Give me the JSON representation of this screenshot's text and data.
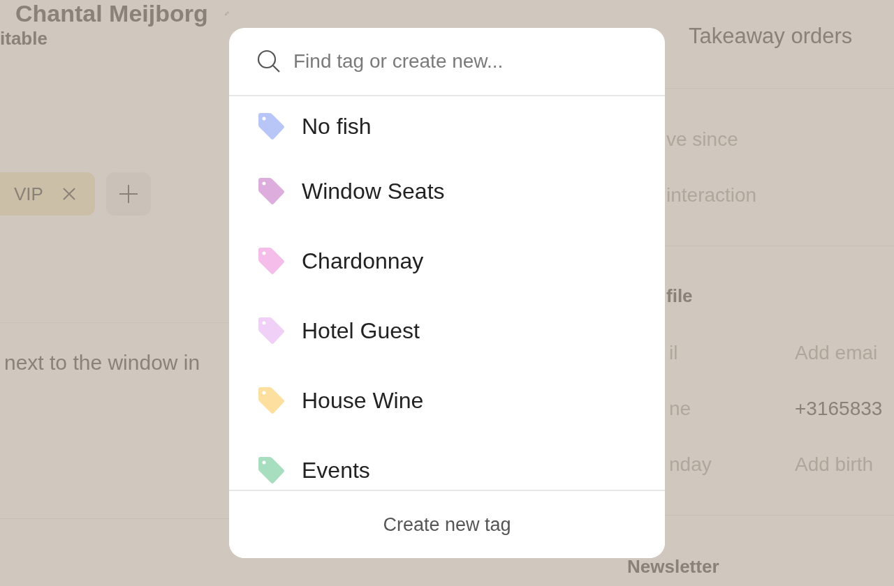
{
  "page": {
    "title": "Chantal Meijborg",
    "section_label": "itable",
    "tags": [
      {
        "label": "VIP"
      }
    ],
    "note": "next to the window in"
  },
  "side": {
    "tab": "Takeaway orders",
    "stats": [
      {
        "label": "ve since"
      },
      {
        "label": "interaction"
      }
    ],
    "profile_heading": "file",
    "profile_fields": [
      {
        "label": "il",
        "value": "Add emai",
        "empty": true
      },
      {
        "label": "ne",
        "value": "+3165833",
        "empty": false
      },
      {
        "label": "nday",
        "value": "Add birth",
        "empty": true
      }
    ],
    "newsletter_heading": "Newsletter"
  },
  "tag_picker": {
    "search": {
      "placeholder": "Find tag or create new..."
    },
    "tags": [
      {
        "name": "No fish",
        "color": "#b8c6f7"
      },
      {
        "name": "Window Seats",
        "color": "#dcaddd"
      },
      {
        "name": "Chardonnay",
        "color": "#f5bde9"
      },
      {
        "name": "Hotel Guest",
        "color": "#f0d0f7"
      },
      {
        "name": "House Wine",
        "color": "#fde0a0"
      },
      {
        "name": "Events",
        "color": "#a8dec0"
      }
    ],
    "create_button": "Create new tag"
  }
}
